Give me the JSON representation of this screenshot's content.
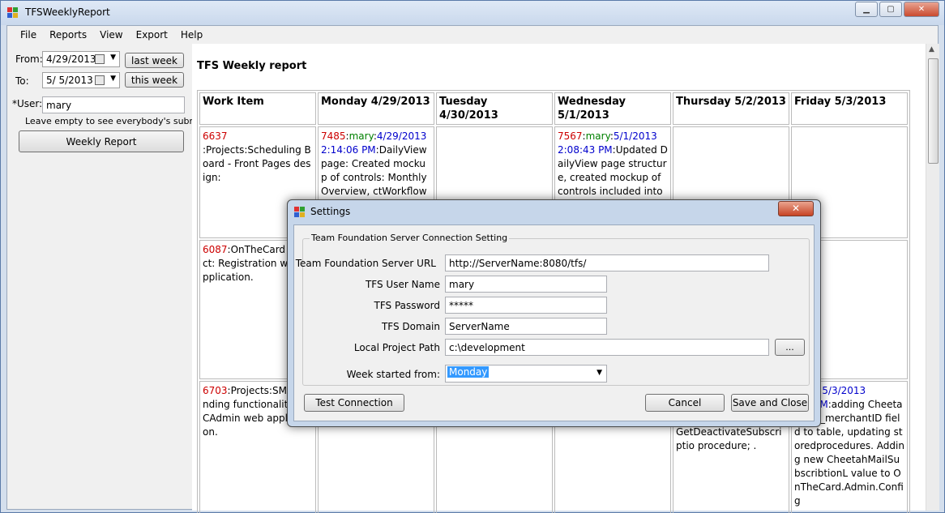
{
  "window": {
    "title": "TFSWeeklyReport",
    "minimize": "▁",
    "maximize": "▢",
    "close": "✕"
  },
  "menu": [
    "File",
    "Reports",
    "View",
    "Export",
    "Help"
  ],
  "left_panel": {
    "from_label": "From:",
    "from_value": "4/29/2013",
    "to_label": "To:",
    "to_value": "5/  5/2013",
    "last_week_label": "last week",
    "this_week_label": "this week",
    "user_label": "*User:",
    "user_value": "mary",
    "hint": "Leave empty to see everybody's submits.",
    "weekly_report_label": "Weekly Report"
  },
  "report": {
    "title": "TFS Weekly report",
    "headers": [
      "Work Item",
      "Monday 4/29/2013",
      "Tuesday 4/30/2013",
      "Wednesday 5/1/2013",
      "Thursday 5/2/2013",
      "Friday 5/3/2013"
    ],
    "rows": [
      {
        "item_id": "6637",
        "item_text": ":Projects:Scheduling Board - Front Pages design:",
        "mon_id": "7485",
        "mon_user": "mary",
        "mon_date": "4/29/2013 2:14:06 PM",
        "mon_text": "DailyView page: Created mockup of controls: MonthlyOverview, ctWorkflow",
        "wed_id": "7567",
        "wed_user": "mary",
        "wed_date": "5/1/2013 2:08:43 PM",
        "wed_text": "Updated DailyView page structure, created mockup of controls included into DailyView"
      },
      {
        "item_id": "6087",
        "item_text": "OnTheCard Project: Registration web application."
      },
      {
        "item_id": "6703",
        "item_text": "Projects:SMS sending functionality OTCAdmin web application.",
        "thu_text": "GetDeactivateSubscriptio procedure; .",
        "fri_user": "mary",
        "fri_date": "5/3/2013",
        "fri_time": ":47 AM",
        "fri_text": "adding CheetahMail_merchantID field to table, updating storedprocedures. Adding new CheetahMailSubscribtionL value to OnTheCard.Admin.Config"
      }
    ]
  },
  "dialog": {
    "title": "Settings",
    "close": "✕",
    "group_caption": "Team Foundation Server Connection Setting",
    "url_label": "Team Foundation Server URL",
    "url_value": "http://ServerName:8080/tfs/",
    "user_label": "TFS User Name",
    "user_value": "mary",
    "password_label": "TFS Password",
    "password_value": "*****",
    "domain_label": "TFS Domain",
    "domain_value": "ServerName",
    "path_label": "Local Project Path",
    "path_value": "c:\\development",
    "browse_label": "...",
    "week_label": "Week started from:",
    "week_value": "Monday",
    "test_label": "Test Connection",
    "cancel_label": "Cancel",
    "save_label": "Save and Close"
  }
}
